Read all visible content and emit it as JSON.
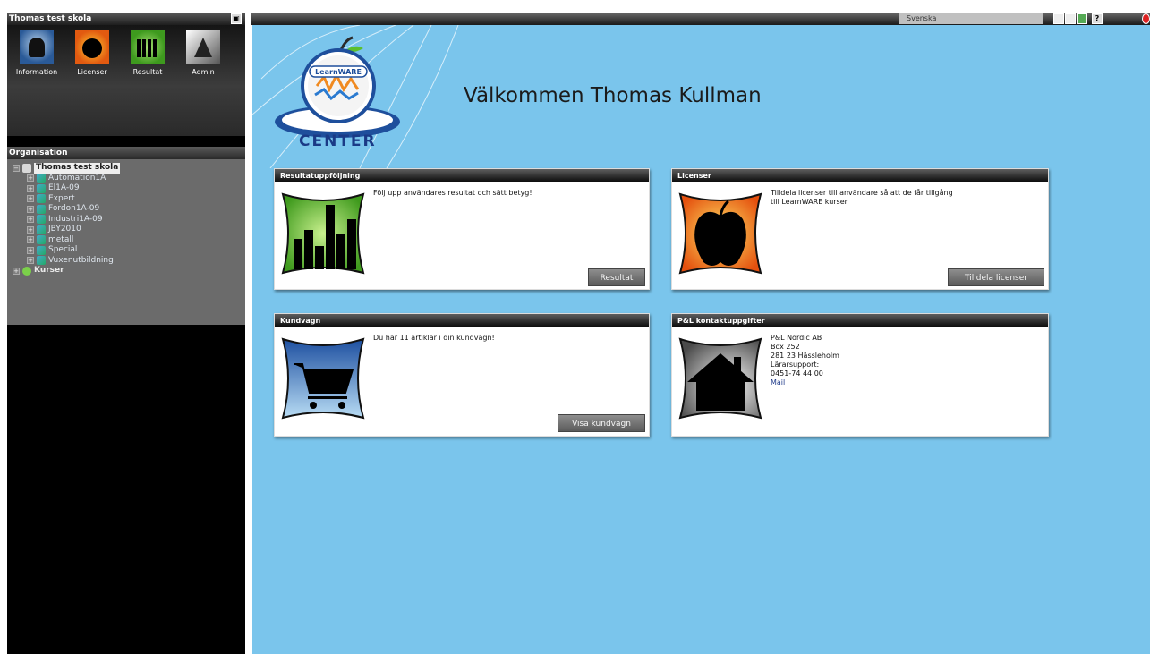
{
  "left_panel": {
    "title": "Thomas test skola",
    "collapse_glyph": "▣",
    "apps": [
      {
        "label": "Information",
        "icon": "information-icon",
        "color": "#2a5a98"
      },
      {
        "label": "Licenser",
        "icon": "apple-icon",
        "color": "#e25a10"
      },
      {
        "label": "Resultat",
        "icon": "chart-icon",
        "color": "#3e9a1e"
      },
      {
        "label": "Admin",
        "icon": "admin-icon",
        "color": "#888888"
      }
    ],
    "org_title": "Organisation",
    "tree": {
      "root": "Thomas test skola",
      "children": [
        "Automation1A",
        "El1A-09",
        "Expert",
        "Fordon1A-09",
        "Industri1A-09",
        "JBY2010",
        "metall",
        "Special",
        "Vuxenutbildning"
      ],
      "kurser": "Kurser"
    }
  },
  "topbar": {
    "language": "Svenska",
    "help_glyph": "?",
    "icons": [
      "minimize-icon",
      "window-icon",
      "screen-icon",
      "help-icon",
      "power-icon"
    ]
  },
  "main": {
    "logo_brand": "LearnWARE",
    "logo_text": "CENTER",
    "welcome": "Välkommen Thomas Kullman",
    "background_color": "#7ac5ec",
    "cards": {
      "resultat": {
        "title": "Resultatuppföljning",
        "text": "Följ upp användares resultat och sätt betyg!",
        "button": "Resultat"
      },
      "licenser": {
        "title": "Licenser",
        "text_line1": "Tilldela licenser till användare så att de får tillgång",
        "text_line2": "till LearnWARE kurser.",
        "button": "Tilldela licenser"
      },
      "kundvagn": {
        "title": "Kundvagn",
        "text": "Du har 11 artiklar i din kundvagn!",
        "button": "Visa kundvagn"
      },
      "kontakt": {
        "title": "P&L kontaktuppgifter",
        "lines": [
          "P&L Nordic AB",
          "Box 252",
          "281 23 Hässleholm",
          "Lärarsupport:",
          "0451-74 44 00"
        ],
        "mail": "Mail"
      }
    }
  }
}
